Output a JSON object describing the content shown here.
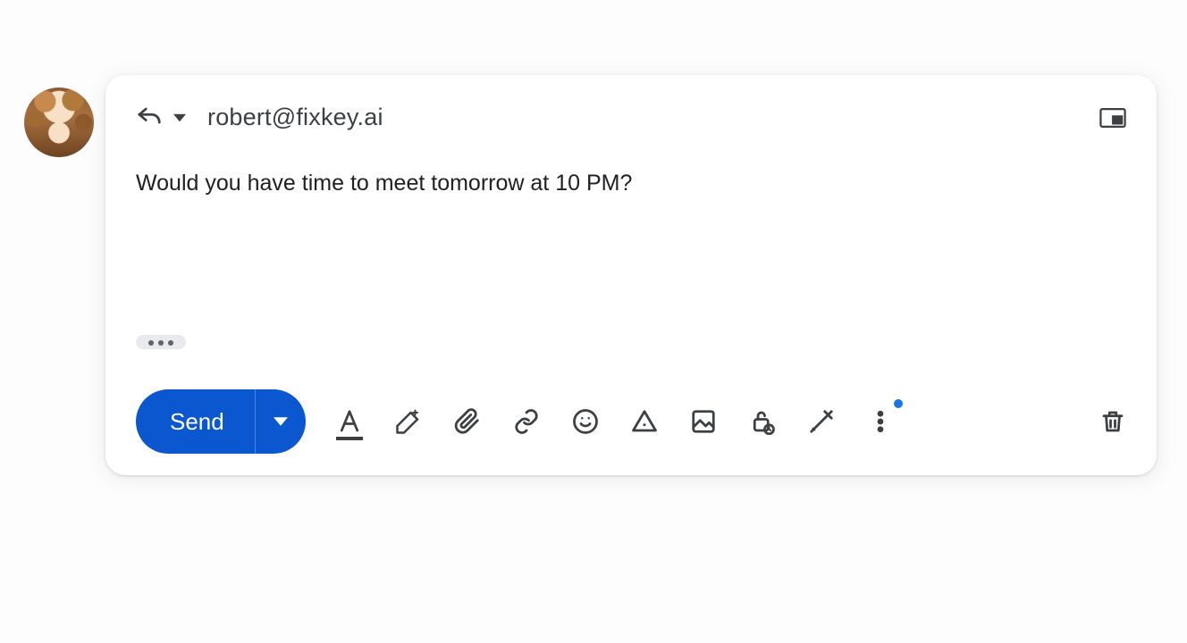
{
  "header": {
    "recipient": "robert@fixkey.ai"
  },
  "message": {
    "body": "Would you have time to meet tomorrow at 10 PM?"
  },
  "toolbar": {
    "send_label": "Send"
  },
  "colors": {
    "primary": "#0b57d0",
    "icon": "#3c4043",
    "text": "#202124",
    "notification_dot": "#1a73e8"
  },
  "icons": {
    "reply": "reply-arrow-icon",
    "reply_dropdown": "caret-down-icon",
    "popout": "popout-window-icon",
    "formatting": "text-format-icon",
    "ai_pen": "sparkle-pen-icon",
    "attach": "paperclip-icon",
    "link": "link-icon",
    "emoji": "emoji-icon",
    "drive": "triangle-warning-icon",
    "image": "image-icon",
    "confidential": "lock-clock-icon",
    "signature": "pen-icon",
    "more": "more-vert-icon",
    "delete": "trash-icon",
    "trimmed": "ellipsis-icon"
  }
}
